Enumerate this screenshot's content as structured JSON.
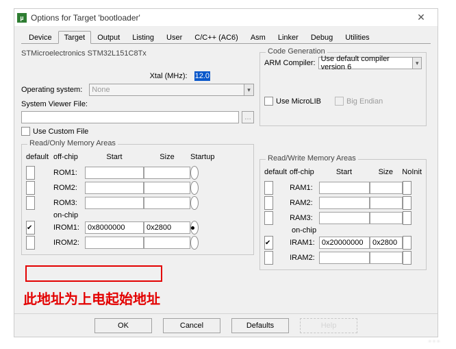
{
  "window": {
    "title": "Options for Target 'bootloader'"
  },
  "tabs": [
    "Device",
    "Target",
    "Output",
    "Listing",
    "User",
    "C/C++ (AC6)",
    "Asm",
    "Linker",
    "Debug",
    "Utilities"
  ],
  "activeTab": 1,
  "device": {
    "name": "STMicroelectronics STM32L151C8Tx"
  },
  "xtal": {
    "label": "Xtal (MHz):",
    "value": "12.0"
  },
  "os": {
    "label": "Operating system:",
    "value": "None"
  },
  "svf": {
    "label": "System Viewer File:",
    "value": ""
  },
  "custom": {
    "label": "Use Custom File",
    "checked": false
  },
  "codegen": {
    "legend": "Code Generation",
    "compilerLabel": "ARM Compiler:",
    "compilerValue": "Use default compiler version 6",
    "microlib": {
      "label": "Use MicroLIB",
      "checked": false
    },
    "endian": {
      "label": "Big Endian",
      "checked": false
    }
  },
  "memRO": {
    "legend": "Read/Only Memory Areas",
    "cols": [
      "default",
      "off-chip",
      "Start",
      "Size",
      "Startup"
    ],
    "onchipLabel": "on-chip",
    "rows": [
      {
        "name": "ROM1:",
        "def": false,
        "start": "",
        "size": "",
        "startup": false
      },
      {
        "name": "ROM2:",
        "def": false,
        "start": "",
        "size": "",
        "startup": false
      },
      {
        "name": "ROM3:",
        "def": false,
        "start": "",
        "size": "",
        "startup": false
      },
      {
        "name": "IROM1:",
        "def": true,
        "start": "0x8000000",
        "size": "0x2800",
        "startup": true,
        "onchip": true
      },
      {
        "name": "IROM2:",
        "def": false,
        "start": "",
        "size": "",
        "startup": false,
        "onchip": true
      }
    ]
  },
  "memRW": {
    "legend": "Read/Write Memory Areas",
    "cols": [
      "default",
      "off-chip",
      "Start",
      "Size",
      "NoInit"
    ],
    "onchipLabel": "on-chip",
    "rows": [
      {
        "name": "RAM1:",
        "def": false,
        "start": "",
        "size": "",
        "noinit": false
      },
      {
        "name": "RAM2:",
        "def": false,
        "start": "",
        "size": "",
        "noinit": false
      },
      {
        "name": "RAM3:",
        "def": false,
        "start": "",
        "size": "",
        "noinit": false
      },
      {
        "name": "IRAM1:",
        "def": true,
        "start": "0x20000000",
        "size": "0x2800",
        "noinit": false,
        "onchip": true
      },
      {
        "name": "IRAM2:",
        "def": false,
        "start": "",
        "size": "",
        "noinit": false,
        "onchip": true
      }
    ]
  },
  "buttons": {
    "ok": "OK",
    "cancel": "Cancel",
    "defaults": "Defaults",
    "help": "Help"
  },
  "annotation": "此地址为上电起始地址"
}
